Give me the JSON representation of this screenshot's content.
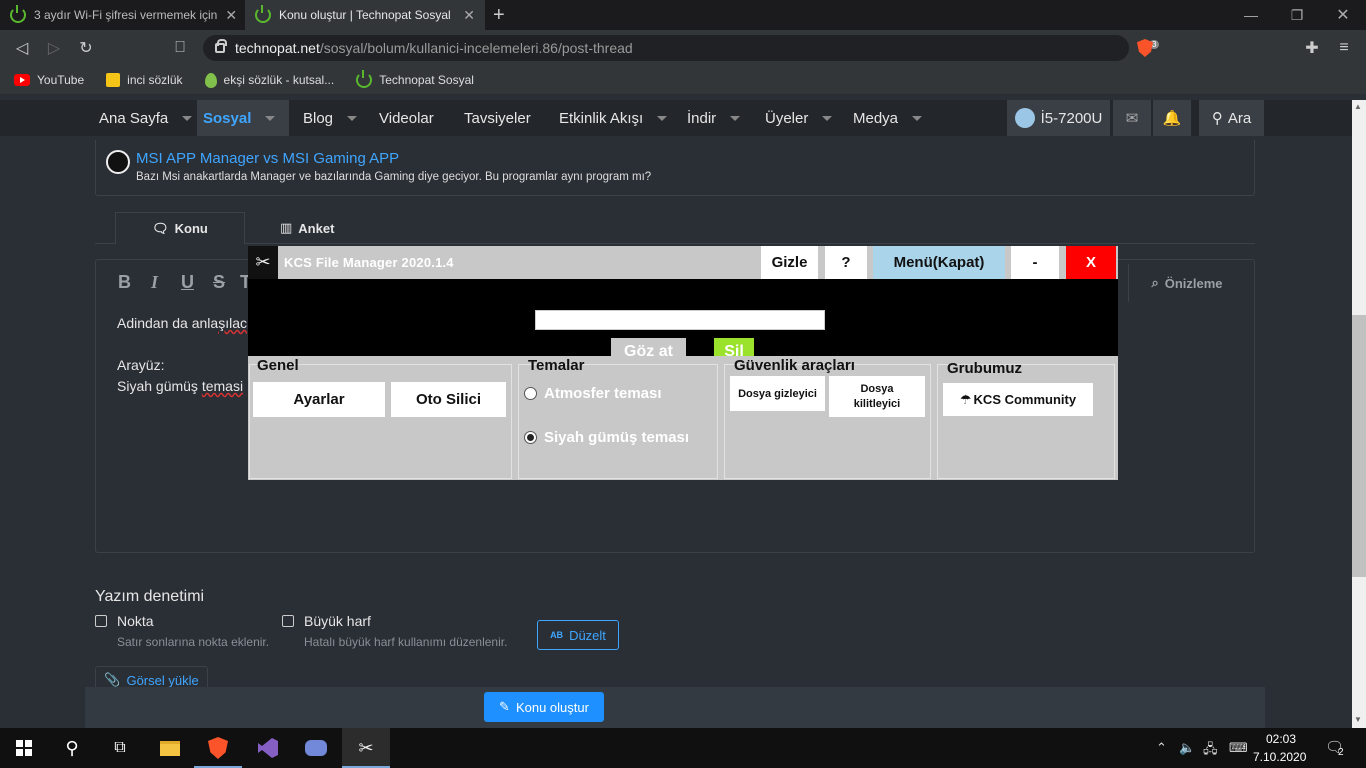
{
  "browser": {
    "tabs": [
      {
        "title": "3 aydır Wi-Fi şifresi vermemek için"
      },
      {
        "title": "Konu oluştur | Technopat Sosyal"
      }
    ],
    "url_host": "technopat.net",
    "url_path": "/sosyal/bolum/kullanici-incelemeleri.86/post-thread",
    "shield_count": "3",
    "bookmarks": [
      "YouTube",
      "inci sözlük",
      "ekşi sözlük - kutsal...",
      "Technopat Sosyal"
    ]
  },
  "site_nav": {
    "items": [
      "Ana Sayfa",
      "Sosyal",
      "Blog",
      "Videolar",
      "Tavsiyeler",
      "Etkinlik Akışı",
      "İndir",
      "Üyeler",
      "Medya"
    ],
    "user": "İ5-7200U",
    "search": "Ara"
  },
  "similar_thread": {
    "title": "MSI APP Manager vs MSI Gaming APP",
    "description": "Bazı Msi anakartlarda Manager ve bazılarında Gaming diye geciyor. Bu programlar aynı program mı?"
  },
  "editor": {
    "tab_konu": "Konu",
    "tab_anket": "Anket",
    "toolbar": [
      "B",
      "I",
      "U",
      "S",
      "T"
    ],
    "preview": "Önizleme",
    "line1_a": "Adindan da anla",
    "line1_b": "şılac",
    "line2": "Arayüz:",
    "line3_a": "Siyah gümüş ",
    "line3_b": "temasi"
  },
  "spellcheck": {
    "title": "Yazım denetimi",
    "opt1_label": "Nokta",
    "opt1_hint": "Satır sonlarına nokta eklenir.",
    "opt2_label": "Büyük harf",
    "opt2_hint": "Hatalı büyük harf kullanımı düzenlenir.",
    "fix_button": "Düzelt",
    "fix_icon_text": "AB"
  },
  "upload_button": "Görsel yükle",
  "submit_button": "Konu oluştur",
  "kcs": {
    "title": "KCS File Manager 2020.1.4",
    "btn_hide": "Gizle",
    "btn_help": "?",
    "btn_menu": "Menü(Kapat)",
    "btn_min": "-",
    "btn_close": "X",
    "btn_browse": "Göz at",
    "btn_delete": "Sil",
    "groups": {
      "general": {
        "title": "Genel",
        "btn1": "Ayarlar",
        "btn2": "Oto Silici"
      },
      "themes": {
        "title": "Temalar",
        "opt1": "Atmosfer teması",
        "opt2": "Siyah gümüş teması",
        "selected": "Siyah gümüş teması"
      },
      "security": {
        "title": "Güvenlik araçları",
        "btn1": "Dosya gizleyici",
        "btn2": "Dosya kilitleyici"
      },
      "group": {
        "title": "Grubumuz",
        "btn1": "KCS Community"
      }
    },
    "colors": {
      "body": "#c8c8c8",
      "black_band": "#000000",
      "menu_button": "#a9d4ea",
      "close_button": "#ff0000",
      "delete_button": "#9be22d"
    }
  },
  "taskbar": {
    "time": "02:03",
    "date": "7.10.2020",
    "notifications": "2"
  },
  "colors": {
    "accent": "#3fa6ff",
    "page_bg": "#2a2e35",
    "nav_bg": "#23272b"
  }
}
